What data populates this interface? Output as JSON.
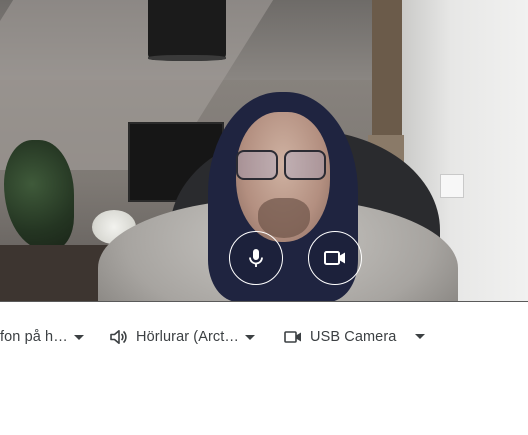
{
  "preview": {
    "mic_button_icon": "microphone-icon",
    "camera_button_icon": "video-camera-icon"
  },
  "devices": {
    "microphone": {
      "label": "fon på h…",
      "icon": "chevron-down-icon"
    },
    "speaker": {
      "label": "Hörlurar (Arct…",
      "icon": "speaker-icon"
    },
    "camera": {
      "label": "USB Camera",
      "icon": "video-camera-icon"
    }
  },
  "colors": {
    "text": "#3c4043",
    "control_border": "#ffffff",
    "background": "#ffffff"
  }
}
